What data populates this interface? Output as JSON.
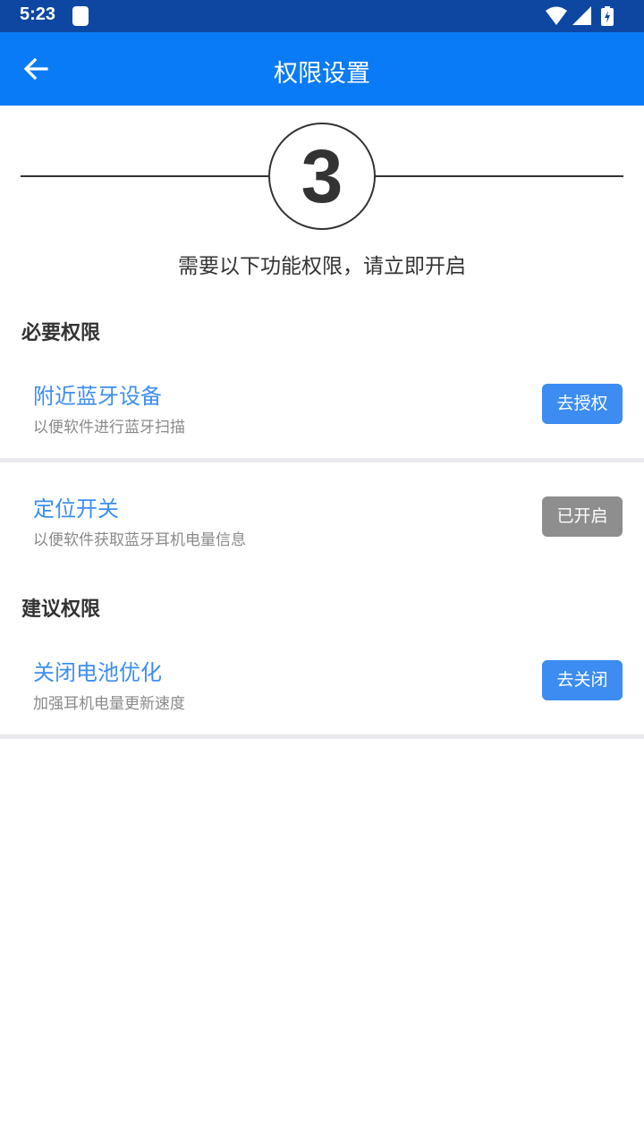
{
  "status_bar": {
    "time": "5:23",
    "icons": [
      "sim-card-icon",
      "wifi-icon",
      "signal-icon",
      "battery-charging-icon"
    ]
  },
  "app_bar": {
    "back_icon": "arrow-left-icon",
    "title": "权限设置"
  },
  "step": {
    "number": "3",
    "hint": "需要以下功能权限，请立即开启"
  },
  "required_section": {
    "title": "必要权限",
    "items": [
      {
        "title": "附近蓝牙设备",
        "desc": "以便软件进行蓝牙扫描",
        "button": "去授权",
        "button_state": "pending"
      },
      {
        "title": "定位开关",
        "desc": "以便软件获取蓝牙耳机电量信息",
        "button": "已开启",
        "button_state": "enabled"
      }
    ]
  },
  "suggested_section": {
    "title": "建议权限",
    "items": [
      {
        "title": "关闭电池优化",
        "desc": "加强耳机电量更新速度",
        "button": "去关闭",
        "button_state": "pending"
      }
    ]
  },
  "colors": {
    "status_bar": "#0d47a1",
    "app_bar": "#0a7bf6",
    "accent_text": "#3d8ef0",
    "button_active": "#3c8cf2",
    "button_disabled": "#8e8e8e"
  }
}
